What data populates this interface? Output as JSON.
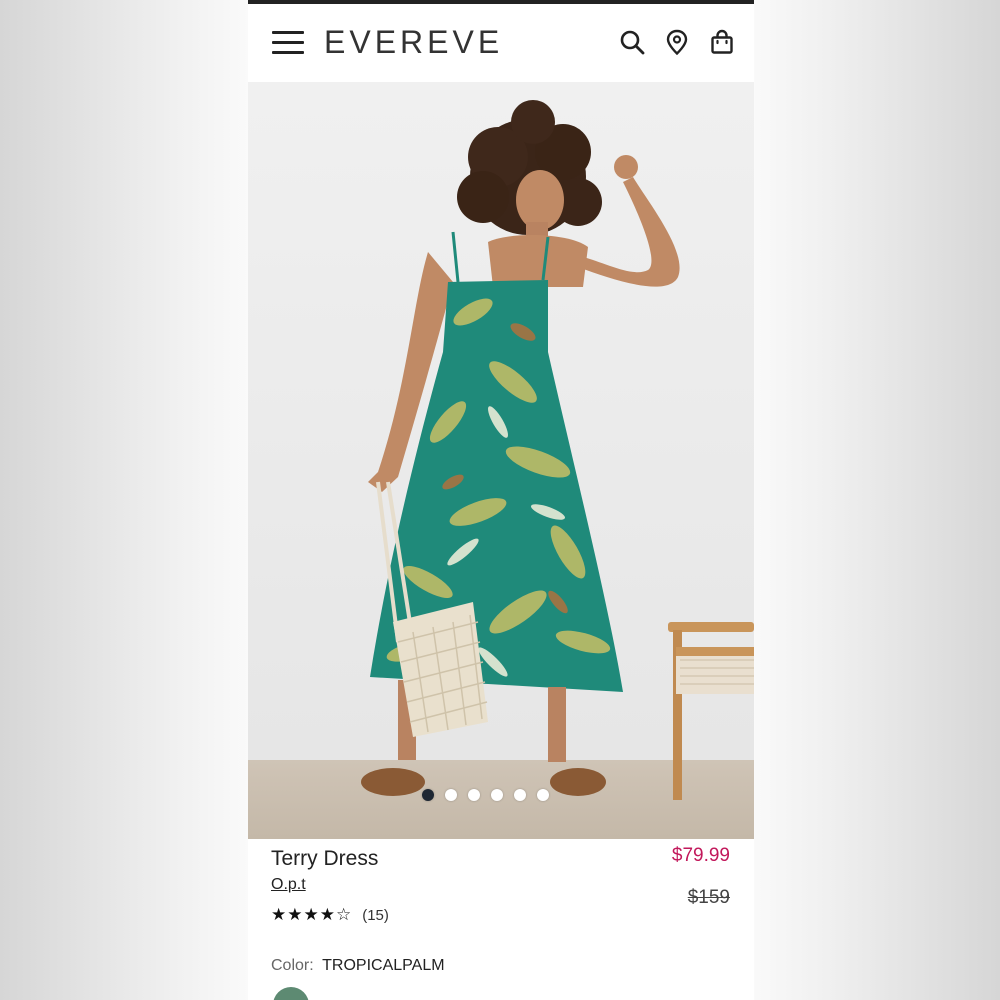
{
  "header": {
    "logo": "EVEREVE",
    "icons": [
      "menu-icon",
      "search-icon",
      "location-pin-icon",
      "shopping-bag-icon"
    ]
  },
  "gallery": {
    "image_count": 6,
    "active_index": 0
  },
  "product": {
    "name": "Terry Dress",
    "brand": "O.p.t",
    "sale_price": "$79.99",
    "original_price": "$159",
    "rating_stars": "★★★★☆",
    "rating": 4,
    "review_count": "(15)",
    "color_label": "Color:",
    "color_value": "TROPICALPALM"
  },
  "colors": {
    "accent_sale": "#c2185b",
    "swatch": "#5d8a72",
    "active_dot": "#1e2733"
  }
}
